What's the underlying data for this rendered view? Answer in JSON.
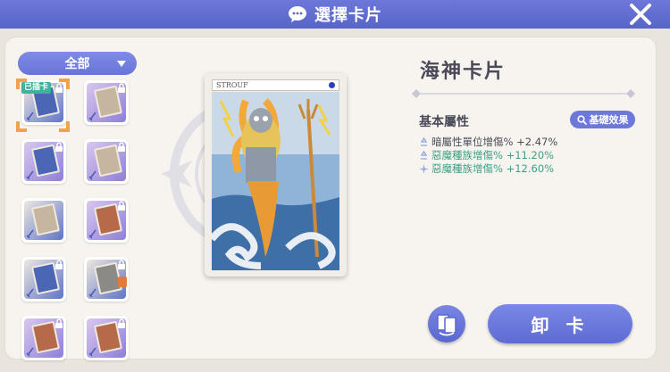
{
  "header": {
    "title": "選擇卡片"
  },
  "filter": {
    "selected": "全部"
  },
  "card_list": {
    "equipped_badge": "已插卡",
    "slots": [
      {
        "art": "blue",
        "card": "blue",
        "locked": true
      },
      {
        "art": "purple",
        "card": "light",
        "locked": true
      },
      {
        "art": "purple",
        "card": "blue",
        "locked": true
      },
      {
        "art": "purple",
        "card": "light",
        "locked": true
      },
      {
        "art": "blue",
        "card": "light",
        "locked": false
      },
      {
        "art": "purple",
        "card": "red",
        "locked": true
      },
      {
        "art": "blue",
        "card": "blue",
        "locked": true
      },
      {
        "art": "blue",
        "card": "gray",
        "locked": true
      },
      {
        "art": "purple",
        "card": "red",
        "locked": true
      },
      {
        "art": "purple",
        "card": "red",
        "locked": true
      }
    ]
  },
  "card_preview": {
    "label": "STROUF"
  },
  "card_info": {
    "name": "海神卡片",
    "section_title": "基本屬性",
    "effect_button": "基礎效果",
    "stats": [
      {
        "text": "暗屬性單位增傷% +2.47%",
        "color": "#4b4a58"
      },
      {
        "text": "惡魔種族增傷% +11.20%",
        "color": "#3b9e86"
      },
      {
        "text": "惡魔種族增傷% +12.60%",
        "color": "#3b9e86"
      }
    ]
  },
  "actions": {
    "unload_label": "卸 卡"
  },
  "colors": {
    "accent": "#6c79d8",
    "header": "#5765c8",
    "panel": "#f7f4ef",
    "stat_green": "#3b9e86",
    "badge_green": "#3cb39a"
  }
}
